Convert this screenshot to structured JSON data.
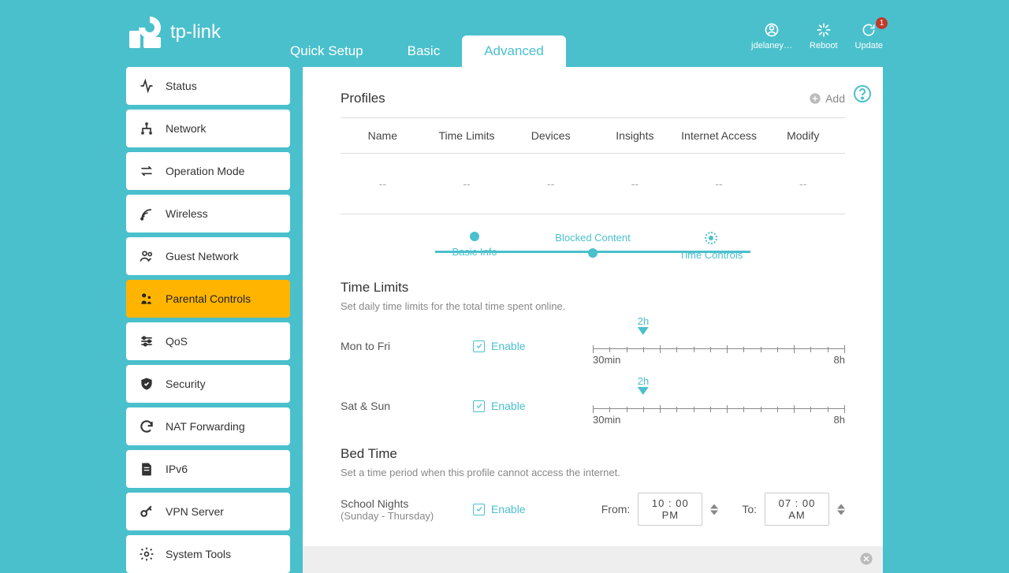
{
  "brand": "tp-link",
  "tabs": {
    "quick_setup": "Quick Setup",
    "basic": "Basic",
    "advanced": "Advanced"
  },
  "header_actions": {
    "user": "jdelaney…",
    "reboot": "Reboot",
    "update": "Update",
    "update_badge": "1"
  },
  "sidebar": {
    "items": [
      {
        "label": "Status"
      },
      {
        "label": "Network"
      },
      {
        "label": "Operation Mode"
      },
      {
        "label": "Wireless"
      },
      {
        "label": "Guest Network"
      },
      {
        "label": "Parental Controls"
      },
      {
        "label": "QoS"
      },
      {
        "label": "Security"
      },
      {
        "label": "NAT Forwarding"
      },
      {
        "label": "IPv6"
      },
      {
        "label": "VPN Server"
      },
      {
        "label": "System Tools"
      }
    ]
  },
  "profiles": {
    "title": "Profiles",
    "add": "Add",
    "columns": {
      "name": "Name",
      "time_limits": "Time Limits",
      "devices": "Devices",
      "insights": "Insights",
      "internet_access": "Internet Access",
      "modify": "Modify"
    },
    "empty_cell": "--"
  },
  "stepper": {
    "basic_info": "Basic Info",
    "blocked_content": "Blocked Content",
    "time_controls": "Time Controls"
  },
  "time_limits": {
    "title": "Time Limits",
    "desc": "Set daily time limits for the total time spent online.",
    "enable": "Enable",
    "mon_fri": "Mon to Fri",
    "sat_sun": "Sat & Sun",
    "slider_value": "2h",
    "slider_min": "30min",
    "slider_max": "8h"
  },
  "bed_time": {
    "title": "Bed Time",
    "desc": "Set a time period when this profile cannot access the internet.",
    "school_nights": "School Nights",
    "school_nights_sub": "(Sunday - Thursday)",
    "enable": "Enable",
    "from": "From:",
    "to": "To:",
    "from_value": "10 : 00  PM",
    "to_value": "07 : 00  AM"
  }
}
